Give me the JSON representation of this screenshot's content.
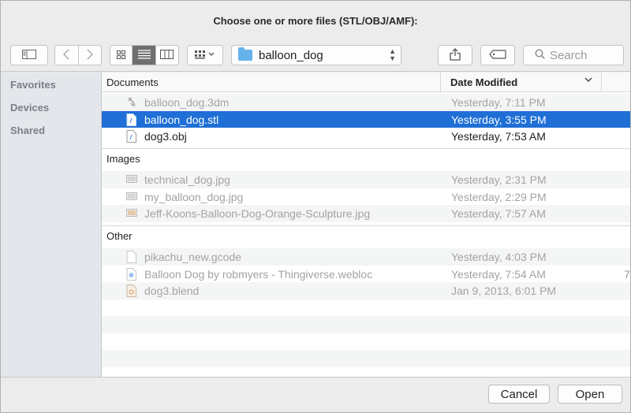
{
  "window": {
    "title": "Choose one or more files (STL/OBJ/AMF):"
  },
  "toolbar": {
    "sidebar_toggle_icon": "sidebar-icon",
    "back_icon": "chevron-left-icon",
    "forward_icon": "chevron-right-icon",
    "view_modes": [
      {
        "icon": "icon-view-icon",
        "selected": false
      },
      {
        "icon": "list-view-icon",
        "selected": true
      },
      {
        "icon": "column-view-icon",
        "selected": false
      }
    ],
    "arrange_icon": "arrange-grid-icon",
    "location": "balloon_dog",
    "share_icon": "share-icon",
    "tag_icon": "tag-icon",
    "search_placeholder": "Search"
  },
  "sidebar": {
    "sections": [
      "Favorites",
      "Devices",
      "Shared"
    ]
  },
  "list": {
    "columns": {
      "name": "Documents",
      "date": "Date Modified"
    },
    "groups": [
      {
        "name": "Documents",
        "items": [
          {
            "name": "balloon_dog.3dm",
            "date": "Yesterday, 7:11 PM",
            "state": "dim",
            "icon": "3dm-file-icon"
          },
          {
            "name": "balloon_dog.stl",
            "date": "Yesterday, 3:55 PM",
            "state": "selected",
            "icon": "document-icon"
          },
          {
            "name": "dog3.obj",
            "date": "Yesterday, 7:53 AM",
            "state": "normal",
            "icon": "document-icon"
          }
        ]
      },
      {
        "name": "Images",
        "items": [
          {
            "name": "technical_dog.jpg",
            "date": "Yesterday, 2:31 PM",
            "state": "dim",
            "icon": "image-file-icon"
          },
          {
            "name": "my_balloon_dog.jpg",
            "date": "Yesterday, 2:29 PM",
            "state": "dim",
            "icon": "image-file-icon"
          },
          {
            "name": "Jeff-Koons-Balloon-Dog-Orange-Sculpture.jpg",
            "date": "Yesterday, 7:57 AM",
            "state": "dim",
            "icon": "image-file-icon"
          }
        ]
      },
      {
        "name": "Other",
        "items": [
          {
            "name": "pikachu_new.gcode",
            "date": "Yesterday, 4:03 PM",
            "state": "dim",
            "icon": "blank-file-icon"
          },
          {
            "name": "Balloon Dog by robmyers - Thingiverse.webloc",
            "date": "Yesterday, 7:54 AM",
            "state": "dim",
            "icon": "webloc-file-icon",
            "extra": "7"
          },
          {
            "name": "dog3.blend",
            "date": "Jan 9, 2013, 6:01 PM",
            "state": "dim",
            "icon": "blend-file-icon"
          }
        ]
      }
    ]
  },
  "footer": {
    "cancel_label": "Cancel",
    "open_label": "Open"
  },
  "colors": {
    "selection": "#1f6fd6",
    "folder": "#66b2ea",
    "dim_text": "#a3a3a3"
  }
}
